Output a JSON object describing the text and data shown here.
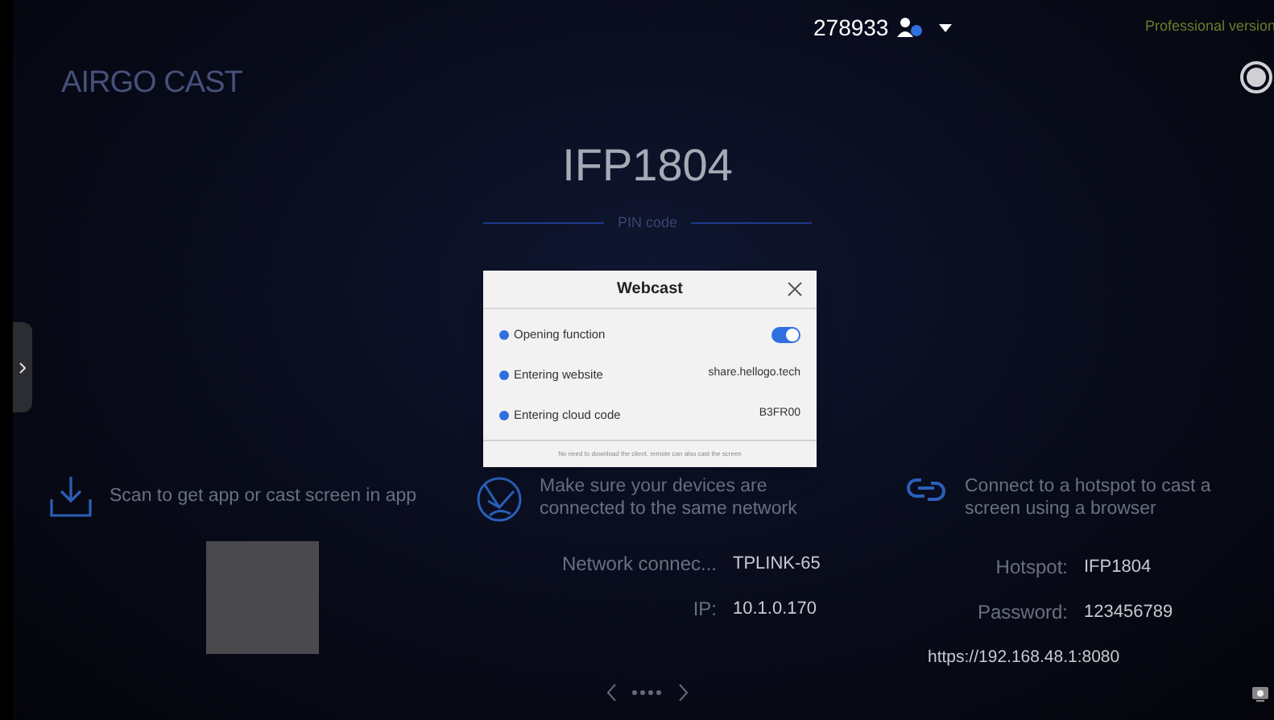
{
  "top_bar": {
    "code": "278933",
    "edition": "Professional version"
  },
  "logo": "AIRGO CAST",
  "device_name": "IFP1804",
  "pin_label": "PIN code",
  "dialog": {
    "title": "Webcast",
    "rows": [
      {
        "kind": "toggle",
        "label": "Opening function",
        "on": true
      },
      {
        "kind": "text",
        "label": "Entering website",
        "value": "share.hellogo.tech"
      },
      {
        "kind": "text",
        "label": "Entering cloud code",
        "value": "B3FR00"
      }
    ],
    "footer": "No need to download the client, remote can also cast the screen"
  },
  "app_section": {
    "text": "Scan to get app or cast screen in app"
  },
  "network_section": {
    "text": "Make sure your devices are connected to the same network",
    "fields": [
      {
        "label": "Network connec...",
        "value": "TPLINK-65"
      },
      {
        "label": "IP:",
        "value": "10.1.0.170"
      }
    ]
  },
  "hotspot_section": {
    "text": "Connect to a hotspot to cast a screen using a browser",
    "fields": [
      {
        "label": "Hotspot:",
        "value": "IFP1804"
      },
      {
        "label": "Password:",
        "value": "123456789"
      }
    ],
    "url": "https://192.168.48.1:8080"
  }
}
